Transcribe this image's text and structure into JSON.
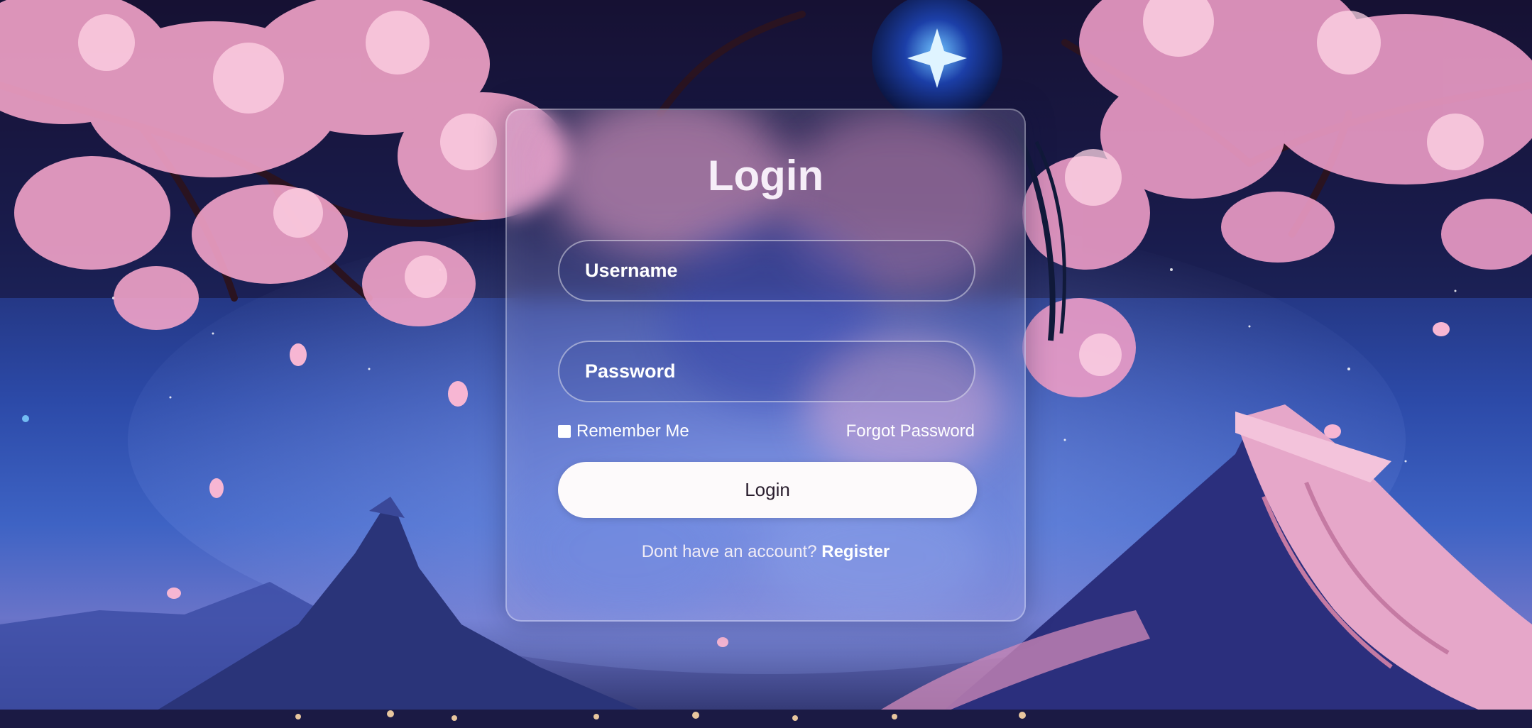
{
  "login": {
    "title": "Login",
    "username_placeholder": "Username",
    "password_placeholder": "Password",
    "remember_label": "Remember Me",
    "forgot_label": "Forgot Password",
    "button_label": "Login",
    "register_prompt": "Dont have an account?",
    "register_label": "Register"
  },
  "colors": {
    "petal": "#f2a3c8",
    "sky": "#2c4aa8",
    "button_bg": "#fdfafb"
  }
}
